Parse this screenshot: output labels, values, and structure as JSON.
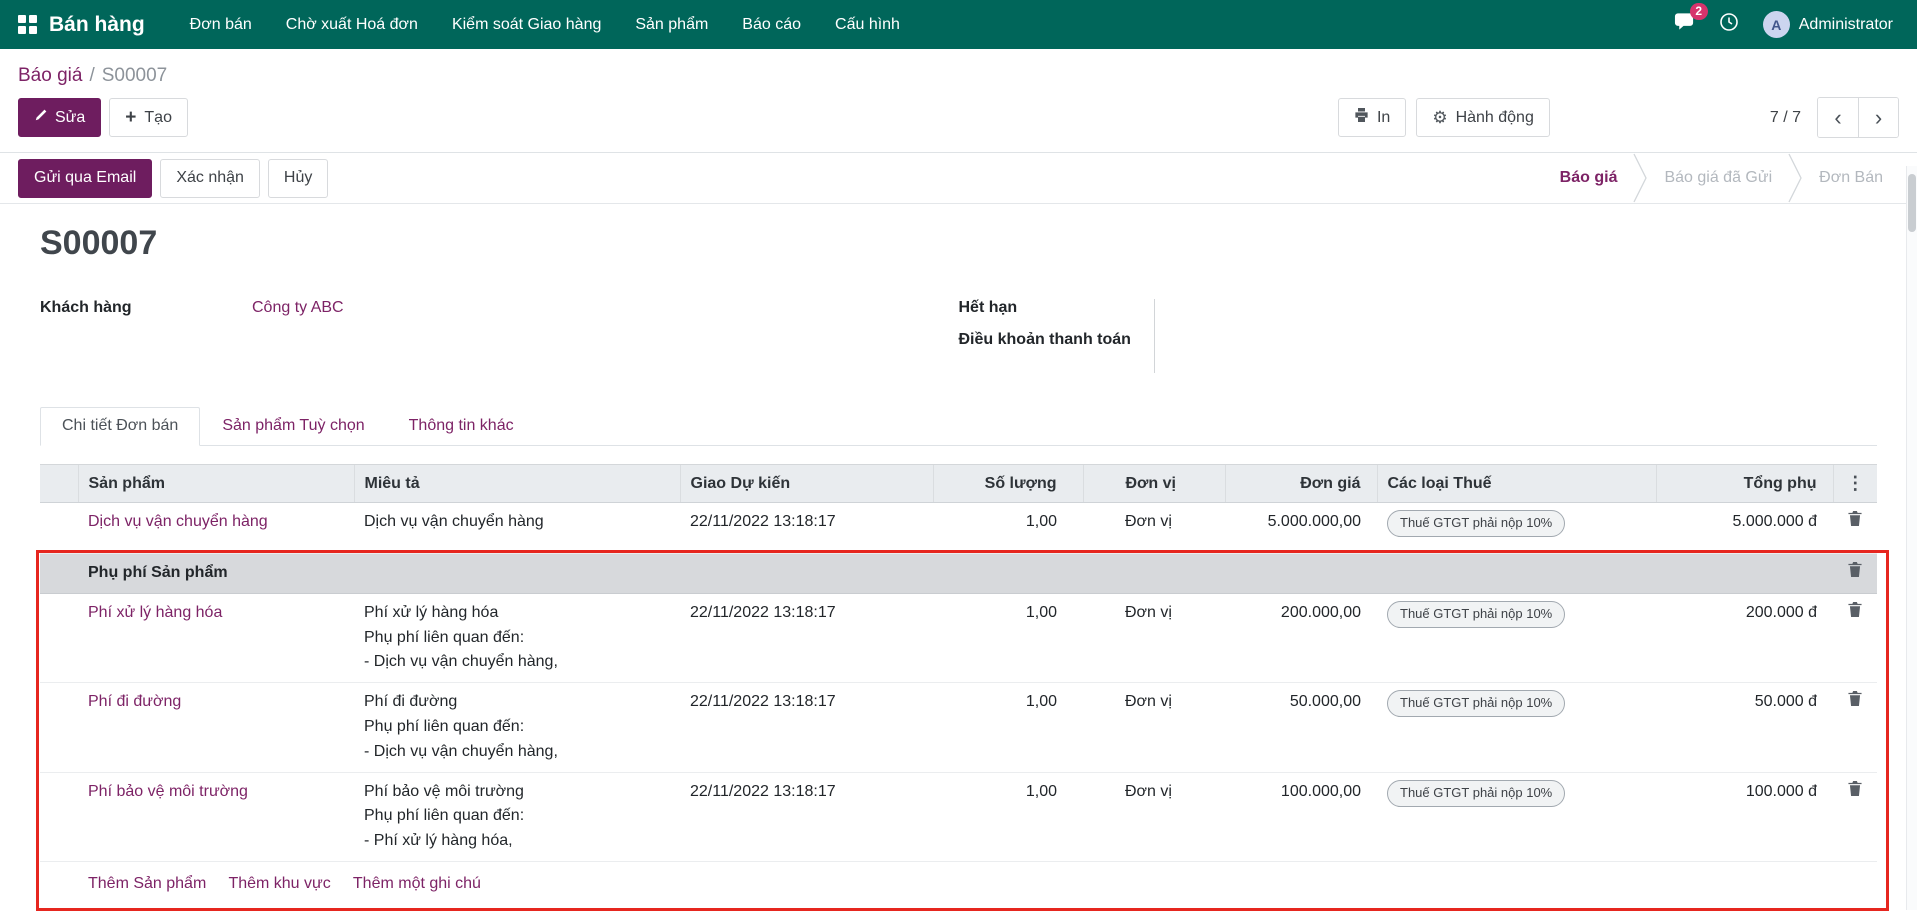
{
  "colors": {
    "nav_bg": "#00665a",
    "primary": "#6e1d5f",
    "link": "#7d2366",
    "badge": "#d6336c",
    "annotation": "#e6261f",
    "section_bg": "#d7d9dc"
  },
  "nav": {
    "brand": "Bán hàng",
    "items": [
      "Đơn bán",
      "Chờ xuất Hoá đơn",
      "Kiểm soát Giao hàng",
      "Sản phẩm",
      "Báo cáo",
      "Cấu hình"
    ],
    "messages_badge": "2",
    "user_initial": "A",
    "user_name": "Administrator"
  },
  "breadcrumb": {
    "parent": "Báo giá",
    "separator": "/",
    "current": "S00007"
  },
  "control_panel": {
    "edit": "Sửa",
    "create": "Tạo",
    "print": "In",
    "action": "Hành động",
    "pager_value": "7 / 7"
  },
  "statusbar": {
    "send_email": "Gửi qua Email",
    "confirm": "Xác nhận",
    "cancel": "Hủy",
    "steps": [
      {
        "label": "Báo giá",
        "active": true
      },
      {
        "label": "Báo giá đã Gửi",
        "active": false
      },
      {
        "label": "Đơn Bán",
        "active": false
      }
    ]
  },
  "sheet": {
    "title": "S00007",
    "customer_label": "Khách hàng",
    "customer_value": "Công ty ABC",
    "expiration_label": "Hết hạn",
    "payment_terms_label": "Điều khoản thanh toán",
    "tabs": [
      {
        "label": "Chi tiết Đơn bán",
        "active": true
      },
      {
        "label": "Sản phẩm Tuỳ chọn",
        "active": false
      },
      {
        "label": "Thông tin khác",
        "active": false
      }
    ],
    "order_lines": {
      "columns": [
        "Sản phẩm",
        "Miêu tả",
        "Giao Dự kiến",
        "Số lượng",
        "Đơn vị",
        "Đơn giá",
        "Các loại Thuế",
        "Tổng phụ"
      ],
      "rows": [
        {
          "type": "product",
          "product": "Dịch vụ vận chuyển hàng",
          "desc": "Dịch vụ vận chuyển hàng",
          "date": "22/11/2022 13:18:17",
          "qty": "1,00",
          "uom": "Đơn vị",
          "price": "5.000.000,00",
          "tax": "Thuế GTGT phải nộp 10%",
          "subtotal": "5.000.000 đ"
        },
        {
          "type": "section",
          "label": "Phụ phí Sản phẩm"
        },
        {
          "type": "product",
          "product": "Phí xử lý hàng hóa",
          "desc": "Phí xử lý hàng hóa\nPhụ phí liên quan đến:\n - Dịch vụ vận chuyển hàng,",
          "date": "22/11/2022 13:18:17",
          "qty": "1,00",
          "uom": "Đơn vị",
          "price": "200.000,00",
          "tax": "Thuế GTGT phải nộp 10%",
          "subtotal": "200.000 đ"
        },
        {
          "type": "product",
          "product": "Phí đi đường",
          "desc": "Phí đi đường\nPhụ phí liên quan đến:\n - Dịch vụ vận chuyển hàng,",
          "date": "22/11/2022 13:18:17",
          "qty": "1,00",
          "uom": "Đơn vị",
          "price": "50.000,00",
          "tax": "Thuế GTGT phải nộp 10%",
          "subtotal": "50.000 đ"
        },
        {
          "type": "product",
          "product": "Phí bảo vệ môi trường",
          "desc": "Phí bảo vệ môi trường\nPhụ phí liên quan đến:\n - Phí xử lý hàng hóa,",
          "date": "22/11/2022 13:18:17",
          "qty": "1,00",
          "uom": "Đơn vị",
          "price": "100.000,00",
          "tax": "Thuế GTGT phải nộp 10%",
          "subtotal": "100.000 đ"
        }
      ],
      "footer_links": [
        "Thêm Sản phẩm",
        "Thêm khu vực",
        "Thêm một ghi chú"
      ]
    }
  }
}
